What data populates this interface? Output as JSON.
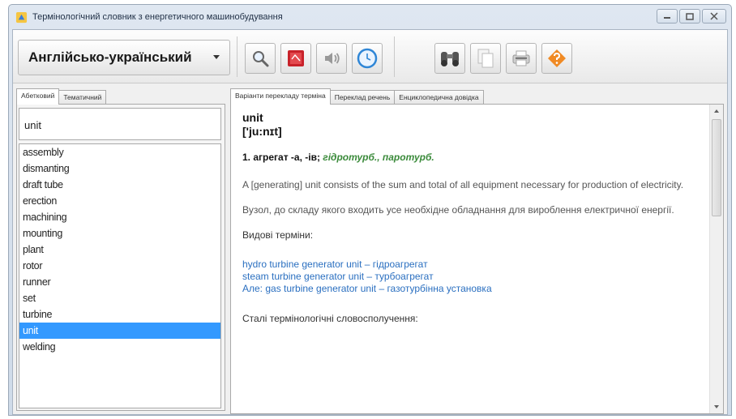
{
  "window": {
    "title": "Термінологічний словник з енергетичного машинобудування"
  },
  "toolbar": {
    "language": "Англійсько-український",
    "buttons": [
      {
        "name": "search-icon"
      },
      {
        "name": "book-icon"
      },
      {
        "name": "speaker-icon"
      },
      {
        "name": "clock-icon"
      },
      {
        "name": "binoculars-icon"
      },
      {
        "name": "copy-icon"
      },
      {
        "name": "printer-icon"
      },
      {
        "name": "help-icon"
      }
    ]
  },
  "left": {
    "tabs": [
      "Абетковий",
      "Тематичний"
    ],
    "search_value": "unit",
    "words": [
      "assembly",
      "dismanting",
      "draft tube",
      "erection",
      "machining",
      "mounting",
      "plant",
      "rotor",
      "runner",
      "set",
      "turbine",
      "unit",
      "welding"
    ],
    "selected_index": 11
  },
  "right": {
    "tabs": [
      "Варіанти перекладу терміна",
      "Переклад речень",
      "Енциклопедична довідка"
    ],
    "headword": "unit",
    "transcription": "['ju:nɪt]",
    "sense_main": "1. агрегат -а, -ів;",
    "sense_domains": "гідротурб., паротурб.",
    "definition_en": "A [generating] unit consists of the sum and total of all equipment necessary for production of electricity.",
    "definition_uk": "Вузол, до складу якого входить усе необхідне обладнання для вироблення електричної енергії.",
    "species_label": "Видові терміни:",
    "species_terms": [
      "hydro turbine generator unit – гідроагрегат",
      "steam turbine generator unit – турбоагрегат",
      "Але: gas turbine generator unit – газотурбінна установка"
    ],
    "phrases_label": "Сталі термінологічні словосполучення:"
  },
  "colors": {
    "selection": "#3399ff",
    "link": "#2a6fc0",
    "domain": "#3a8a3a"
  }
}
